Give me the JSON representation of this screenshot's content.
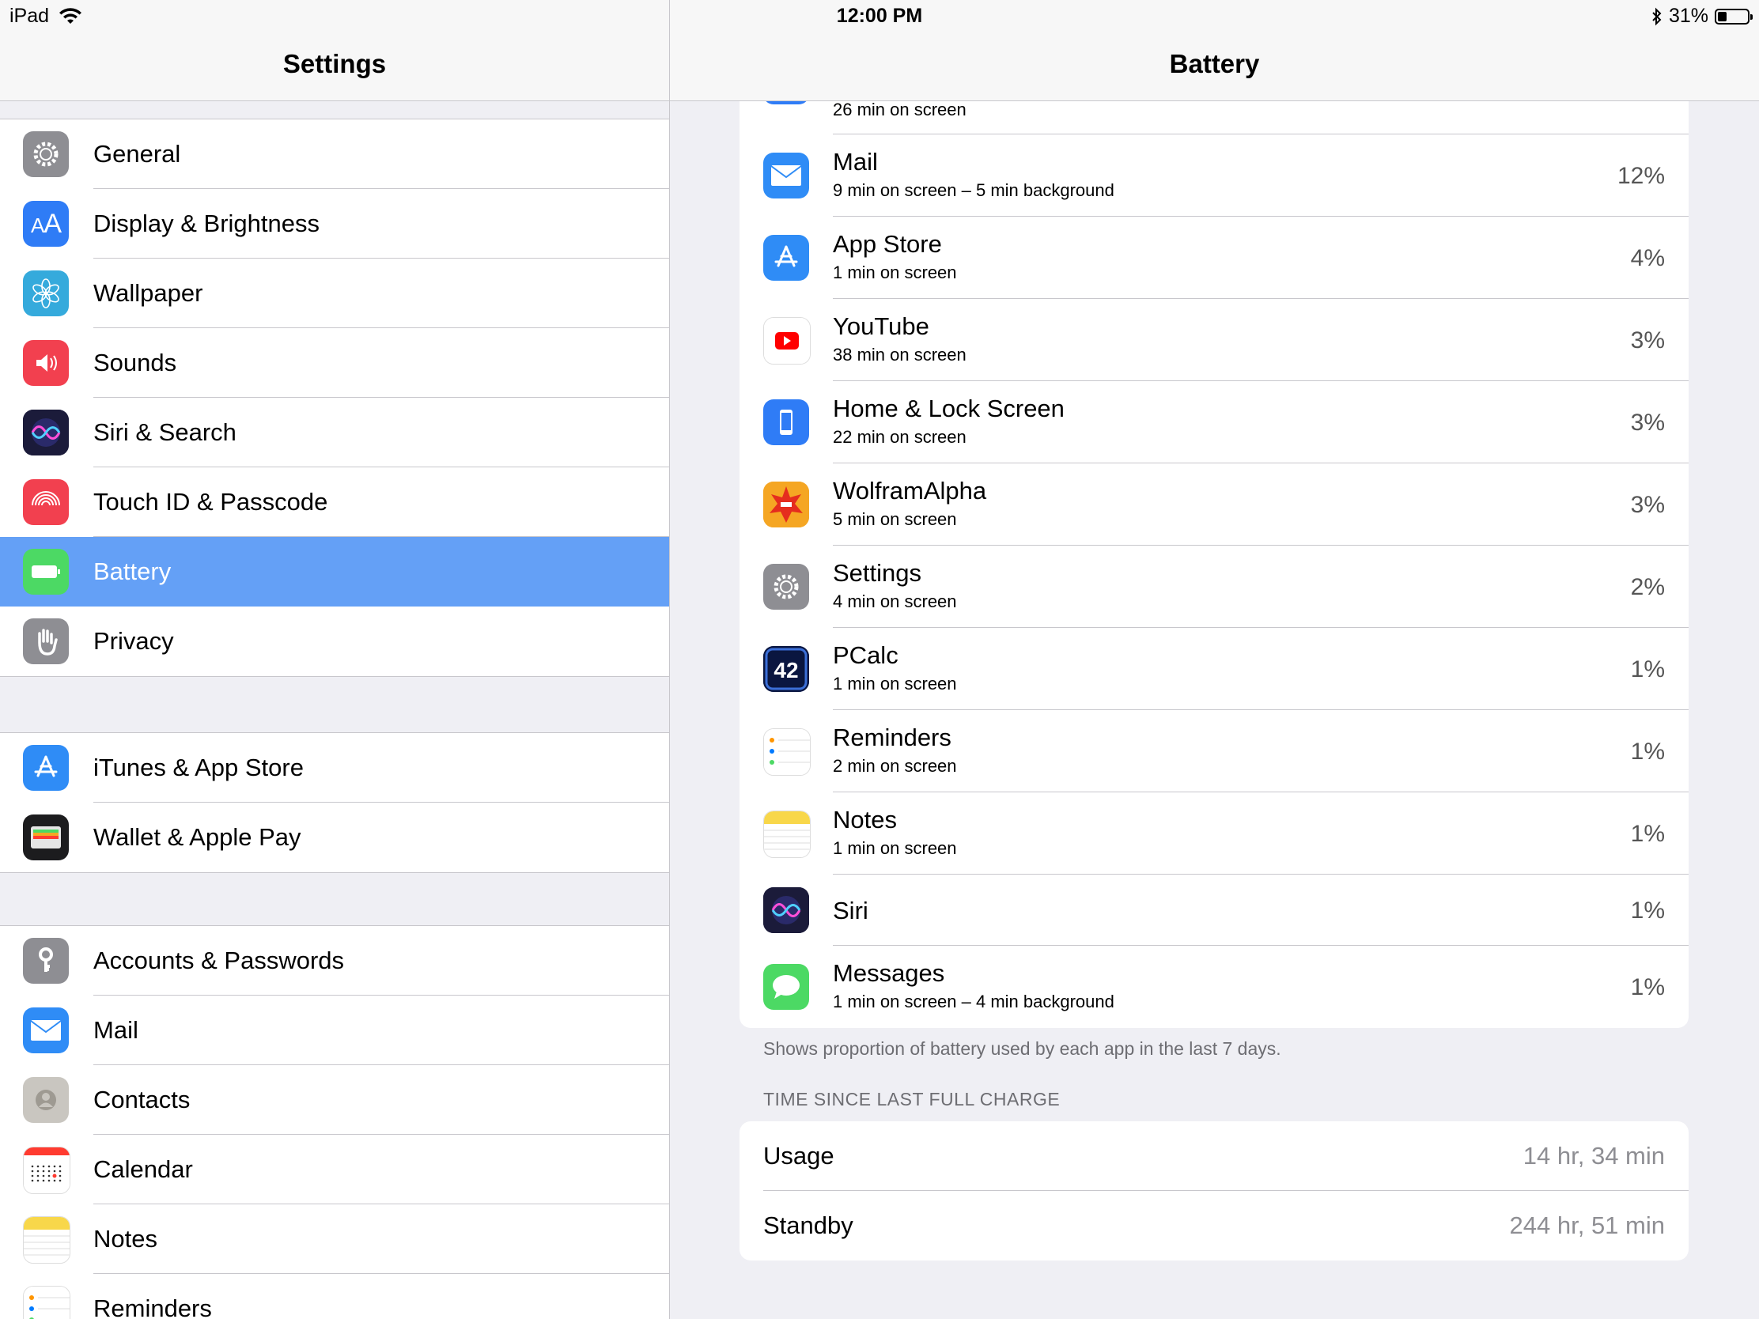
{
  "status_bar": {
    "device": "iPad",
    "time": "12:00 PM",
    "battery_percent": "31%",
    "battery_level": 0.31
  },
  "master": {
    "title": "Settings",
    "groups": [
      [
        {
          "label": "General",
          "icon": "gear-icon",
          "color": "#8e8e93"
        },
        {
          "label": "Display & Brightness",
          "icon": "text-size-icon",
          "color": "#2f7cf6"
        },
        {
          "label": "Wallpaper",
          "icon": "flower-icon",
          "color": "#35aadc"
        },
        {
          "label": "Sounds",
          "icon": "speaker-icon",
          "color": "#f2404f"
        },
        {
          "label": "Siri & Search",
          "icon": "siri-icon",
          "color": "#222244"
        },
        {
          "label": "Touch ID & Passcode",
          "icon": "fingerprint-icon",
          "color": "#f2404f"
        },
        {
          "label": "Battery",
          "icon": "battery-icon",
          "color": "#4cd964",
          "selected": true
        },
        {
          "label": "Privacy",
          "icon": "hand-icon",
          "color": "#8e8e93"
        }
      ],
      [
        {
          "label": "iTunes & App Store",
          "icon": "app-store-icon",
          "color": "#2f8cf6"
        },
        {
          "label": "Wallet & Apple Pay",
          "icon": "wallet-icon",
          "color": "#1c1c1e"
        }
      ],
      [
        {
          "label": "Accounts & Passwords",
          "icon": "key-icon",
          "color": "#8e8e93"
        },
        {
          "label": "Mail",
          "icon": "mail-icon",
          "color": "#2f8cf6"
        },
        {
          "label": "Contacts",
          "icon": "contacts-icon",
          "color": "#c9c6c0"
        },
        {
          "label": "Calendar",
          "icon": "calendar-icon",
          "color": "#ffffff"
        },
        {
          "label": "Notes",
          "icon": "notes-icon",
          "color": "#ffffff"
        },
        {
          "label": "Reminders",
          "icon": "reminders-icon",
          "color": "#ffffff"
        }
      ]
    ]
  },
  "detail": {
    "title": "Battery",
    "partial_row": {
      "sub": "26 min on screen"
    },
    "apps": [
      {
        "name": "Mail",
        "sub": "9 min on screen – 5 min background",
        "pct": "12%",
        "icon": "mail-icon",
        "color": "#2f8cf6"
      },
      {
        "name": "App Store",
        "sub": "1 min on screen",
        "pct": "4%",
        "icon": "app-store-icon",
        "color": "#2f8cf6"
      },
      {
        "name": "YouTube",
        "sub": "38 min on screen",
        "pct": "3%",
        "icon": "youtube-icon",
        "color": "#ffffff"
      },
      {
        "name": "Home & Lock Screen",
        "sub": "22 min on screen",
        "pct": "3%",
        "icon": "phone-screen-icon",
        "color": "#2f7cf6"
      },
      {
        "name": "WolframAlpha",
        "sub": "5 min on screen",
        "pct": "3%",
        "icon": "wolfram-icon",
        "color": "#f5a623"
      },
      {
        "name": "Settings",
        "sub": "4 min on screen",
        "pct": "2%",
        "icon": "gear-icon",
        "color": "#8e8e93"
      },
      {
        "name": "PCalc",
        "sub": "1 min on screen",
        "pct": "1%",
        "icon": "pcalc-icon",
        "color": "#1a3a8a",
        "icon_text": "42"
      },
      {
        "name": "Reminders",
        "sub": "2 min on screen",
        "pct": "1%",
        "icon": "reminders-icon",
        "color": "#ffffff"
      },
      {
        "name": "Notes",
        "sub": "1 min on screen",
        "pct": "1%",
        "icon": "notes-icon",
        "color": "#ffffff"
      },
      {
        "name": "Siri",
        "sub": "",
        "pct": "1%",
        "icon": "siri-icon",
        "color": "#222244"
      },
      {
        "name": "Messages",
        "sub": "1 min on screen – 4 min background",
        "pct": "1%",
        "icon": "messages-icon",
        "color": "#4cd964"
      }
    ],
    "footnote": "Shows proportion of battery used by each app in the last 7 days.",
    "time_header": "TIME SINCE LAST FULL CHARGE",
    "usage": {
      "label": "Usage",
      "value": "14 hr, 34 min"
    },
    "standby": {
      "label": "Standby",
      "value": "244 hr, 51 min"
    }
  }
}
